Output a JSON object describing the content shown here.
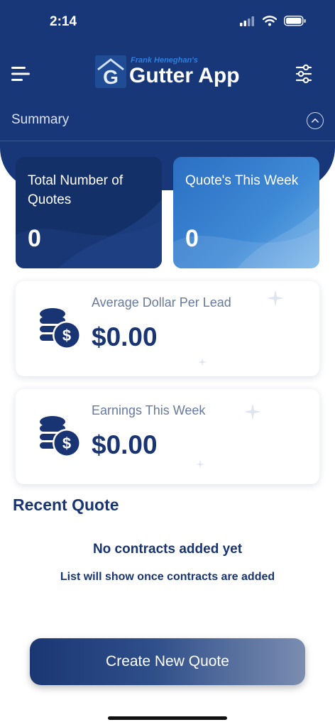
{
  "status_bar": {
    "time": "2:14"
  },
  "header": {
    "logo_subtitle": "Frank Heneghan's",
    "logo_title": "Gutter App",
    "logo_letter": "G"
  },
  "summary": {
    "label": "Summary"
  },
  "cards": {
    "total_quotes": {
      "title": "Total Number of Quotes",
      "value": "0"
    },
    "quotes_week": {
      "title": "Quote's This Week",
      "value": "0"
    }
  },
  "stats": {
    "avg_per_lead": {
      "label": "Average Dollar Per Lead",
      "value": "$0.00"
    },
    "earnings_week": {
      "label": "Earnings This Week",
      "value": "$0.00"
    }
  },
  "recent": {
    "title": "Recent Quote",
    "empty_title": "No contracts added yet",
    "empty_subtitle": "List will show once contracts are added"
  },
  "actions": {
    "create_label": "Create New Quote"
  },
  "icons": {
    "menu": "menu-icon",
    "filter": "sliders-icon",
    "collapse": "chevron-up-icon",
    "coins": "coins-dollar-icon"
  },
  "colors": {
    "header": "#183778",
    "primary_text": "#183472",
    "card_dark": "#143069",
    "card_blue": "#3f8ad6"
  }
}
